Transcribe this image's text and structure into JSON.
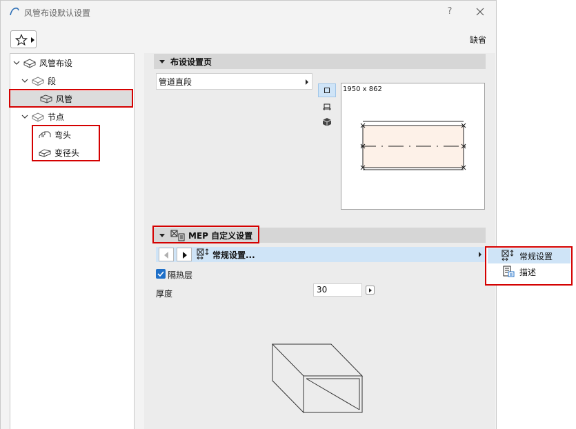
{
  "window": {
    "title": "风管布设默认设置",
    "help_symbol": "?",
    "default_label": "缺省"
  },
  "tree": {
    "items": [
      {
        "label": "风管布设",
        "icon": "duct-routing-icon"
      },
      {
        "label": "段",
        "icon": "segment-icon"
      },
      {
        "label": "风管",
        "icon": "duct-icon",
        "selected": true
      },
      {
        "label": "节点",
        "icon": "node-icon"
      },
      {
        "label": "弯头",
        "icon": "elbow-icon"
      },
      {
        "label": "变径头",
        "icon": "reducer-icon"
      }
    ]
  },
  "layout_section": {
    "title": "布设设置页",
    "combo_value": "管道直段",
    "preview_dims": "1950 x 862"
  },
  "mep_section": {
    "title": "MEP 自定义设置",
    "nav_label": "常规设置...",
    "insulation_label": "隔热层",
    "insulation_checked": true,
    "thickness_label": "厚度",
    "thickness_value": "30"
  },
  "popup_menu": {
    "items": [
      {
        "label": "常规设置",
        "icon": "general-settings-icon"
      },
      {
        "label": "描述",
        "icon": "description-icon"
      }
    ]
  },
  "colors": {
    "highlight": "#d40000",
    "selection_blue": "#cfe4f7",
    "checkbox": "#1e6fc8",
    "preview_fill": "#fdf1e8"
  }
}
